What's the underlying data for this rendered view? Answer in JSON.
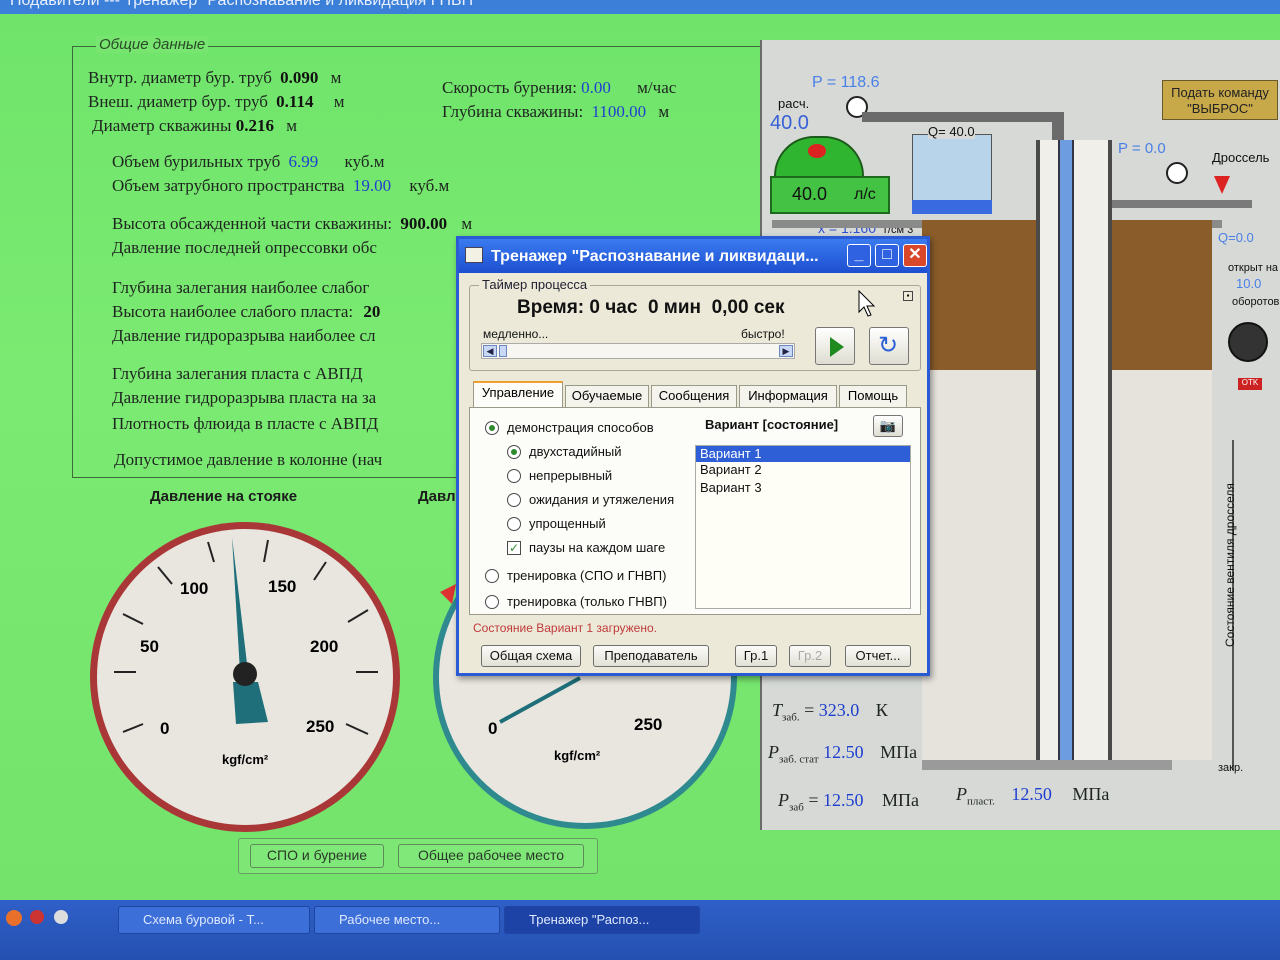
{
  "window": {
    "title": "Подавители --- Тренажер \"Распознавание и ликвидация ГНВП\""
  },
  "general": {
    "group_title": "Общие данные",
    "inner_diam_label": "Внутр. диаметр бур. труб",
    "inner_diam_value": "0.090",
    "inner_diam_unit": "м",
    "outer_diam_label": "Внеш. диаметр бур. труб",
    "outer_diam_value": "0.114",
    "outer_diam_unit": "м",
    "well_diam_label": "Диаметр скважины",
    "well_diam_value": "0.216",
    "well_diam_unit": "м",
    "drill_speed_label": "Скорость бурения:",
    "drill_speed_value": "0.00",
    "drill_speed_unit": "м/час",
    "well_depth_label": "Глубина скважины:",
    "well_depth_value": "1100.00",
    "well_depth_unit": "м",
    "pipe_volume_label": "Объем бурильных труб",
    "pipe_volume_value": "6.99",
    "pipe_volume_unit": "куб.м",
    "annulus_volume_label": "Объем затрубного пространства",
    "annulus_volume_value": "19.00",
    "annulus_volume_unit": "куб.м",
    "cased_height_label": "Высота обсажденной части скважины:",
    "cased_height_value": "900.00",
    "cased_height_unit": "м",
    "last_test_label": "Давление последней опрессовки обс",
    "weak_depth_label": "Глубина залегания наиболее слабог",
    "weak_height_label": "Высота наиболее слабого пласта:",
    "weak_height_value": "20",
    "weak_frac_label": "Давление гидроразрыва наиболее сл",
    "avpd_depth_label": "Глубина залегания пласта с АВПД",
    "avpd_frac_label": "Давление гидроразрыва пласта на за",
    "avpd_density_label": "Плотность флюида в пласте с АВПД",
    "allowed_pressure_label": "Допустимое давление в колонне (нач"
  },
  "gauges": {
    "standpipe_title": "Давление на стояке",
    "casing_title": "Давл",
    "unit": "kgf/cm²",
    "ticks1": [
      "0",
      "50",
      "100",
      "150",
      "200",
      "250"
    ],
    "ticks2": [
      "0",
      "250"
    ]
  },
  "bottom_buttons": {
    "spo": "СПО и бурение",
    "workplace": "Общее рабочее место"
  },
  "scheme": {
    "p_label": "P = 118.6",
    "calc_label": "расч.",
    "calc_value": "40.0",
    "pump_value": "40.0",
    "pump_unit": "л/с",
    "q_label": "Q= 40.0",
    "p2_label": "P = 0.0",
    "x_label": "x = 1.160",
    "x_unit": "г/см 3",
    "choke_label": "Дроссель",
    "q2_label": "Q=0.0",
    "open_label": "открыт на",
    "open_value": "10.0",
    "turns_label": "оборотов",
    "kick_button": "Подать команду \"ВЫБРОС\"",
    "choke_state_label": "Состояние вентиля дросселя",
    "closed_label": "закр.",
    "t_bottom_label": "T",
    "t_bottom_sub": "заб.",
    "t_bottom_value": "323.0",
    "t_bottom_unit": "К",
    "p_static_label": "P",
    "p_static_sub": "заб. стат",
    "p_static_value": "12.50",
    "p_static_unit": "МПа",
    "p_bottom_label": "P",
    "p_bottom_sub": "заб",
    "p_bottom_value": "12.50",
    "p_bottom_unit": "МПа",
    "p_layer_label": "P",
    "p_layer_sub": "пласт.",
    "p_layer_value": "12.50",
    "p_layer_unit": "МПа",
    "otk_label": "OTK"
  },
  "dialog": {
    "title": "Тренажер \"Распознавание и ликвидаци...",
    "timer_group": "Таймер процесса",
    "time_text": "Время: 0 час  0 мин  0,00 сек",
    "slow_label": "медленно...",
    "fast_label": "быстро!",
    "tabs": [
      "Управление",
      "Обучаемые",
      "Сообщения",
      "Информация",
      "Помощь"
    ],
    "demo_label": "демонстрация способов",
    "two_stage_label": "двухстадийный",
    "continuous_label": "непрерывный",
    "wait_weight_label": "ожидания и утяжеления",
    "simplified_label": "упрощенный",
    "pauses_label": "паузы на каждом шаге",
    "training_spo_label": "тренировка (СПО и ГНВП)",
    "training_gnvp_label": "тренировка (только ГНВП)",
    "variant_header": "Вариант [состояние]",
    "variants": [
      "Вариант 1",
      "Вариант 2",
      "Вариант 3"
    ],
    "status_text": "Состояние Вариант 1 загружено.",
    "btn_scheme": "Общая схема",
    "btn_teacher": "Преподаватель",
    "btn_gr1": "Гр.1",
    "btn_gr2": "Гр.2",
    "btn_report": "Отчет..."
  },
  "taskbar": {
    "items": [
      "Схема буровой - Т...",
      "Рабочее место...",
      "Тренажер \"Распоз..."
    ]
  }
}
